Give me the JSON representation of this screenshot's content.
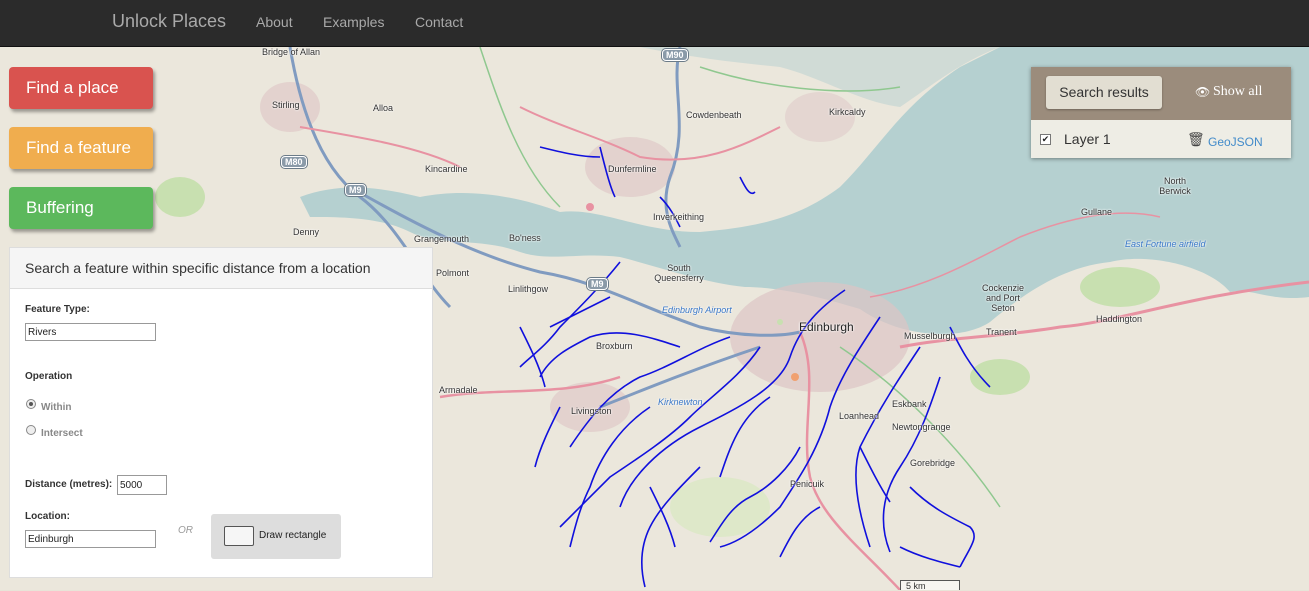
{
  "navbar": {
    "brand": "Unlock Places",
    "links": [
      "About",
      "Examples",
      "Contact"
    ]
  },
  "map": {
    "labels": {
      "bridge_of_allan": "Bridge of Allan",
      "stirling": "Stirling",
      "alloa": "Alloa",
      "kincardine": "Kincardine",
      "denny": "Denny",
      "grangemouth": "Grangemouth",
      "polmont": "Polmont",
      "boness": "Bo'ness",
      "linlithgow": "Linlithgow",
      "broxburn": "Broxburn",
      "armadale": "Armadale",
      "livingston": "Livingston",
      "dunfermline": "Dunfermline",
      "inverkeithing": "Inverkeithing",
      "cowdenbeath": "Cowdenbeath",
      "kirkcaldy": "Kirkcaldy",
      "south_queensferry": "South Queensferry",
      "edinburgh_airport": "Edinburgh Airport",
      "edinburgh": "Edinburgh",
      "kirknewton": "Kirknewton",
      "musselburgh": "Musselburgh",
      "loanhead": "Loanhead",
      "eskbank": "Eskbank",
      "newtongrange": "Newtongrange",
      "penicuik": "Penicuik",
      "gorebridge": "Gorebridge",
      "cockenzie": "Cockenzie and Port Seton",
      "tranent": "Tranent",
      "haddington": "Haddington",
      "north_berwick": "North Berwick",
      "gullane": "Gullane",
      "east_fortune": "East Fortune airfield"
    },
    "shields": {
      "m90": "M90",
      "m80": "M80",
      "m9a": "M9",
      "m9b": "M9"
    },
    "scale": "5 km",
    "colors": {
      "land": "#e8e4d8",
      "water": "#b5d0d0",
      "river": "#1010dd",
      "motorway": "#809bc0",
      "primary": "#e892a2"
    }
  },
  "actions": {
    "find_place": "Find a place",
    "find_feature": "Find a feature",
    "buffering": "Buffering"
  },
  "panel": {
    "title": "Search a feature within specific distance from a location",
    "feature_type_label": "Feature Type:",
    "feature_type_value": "Rivers",
    "operation_label": "Operation",
    "within": "Within",
    "intersect": "Intersect",
    "distance_label": "Distance (metres):",
    "distance_value": "5000",
    "location_label": "Location:",
    "location_value": "Edinburgh",
    "or": "OR",
    "draw_rectangle": "Draw rectangle"
  },
  "results": {
    "search_results": "Search results",
    "show_all": "Show all",
    "layer": "Layer 1",
    "geojson": "GeoJSON"
  }
}
